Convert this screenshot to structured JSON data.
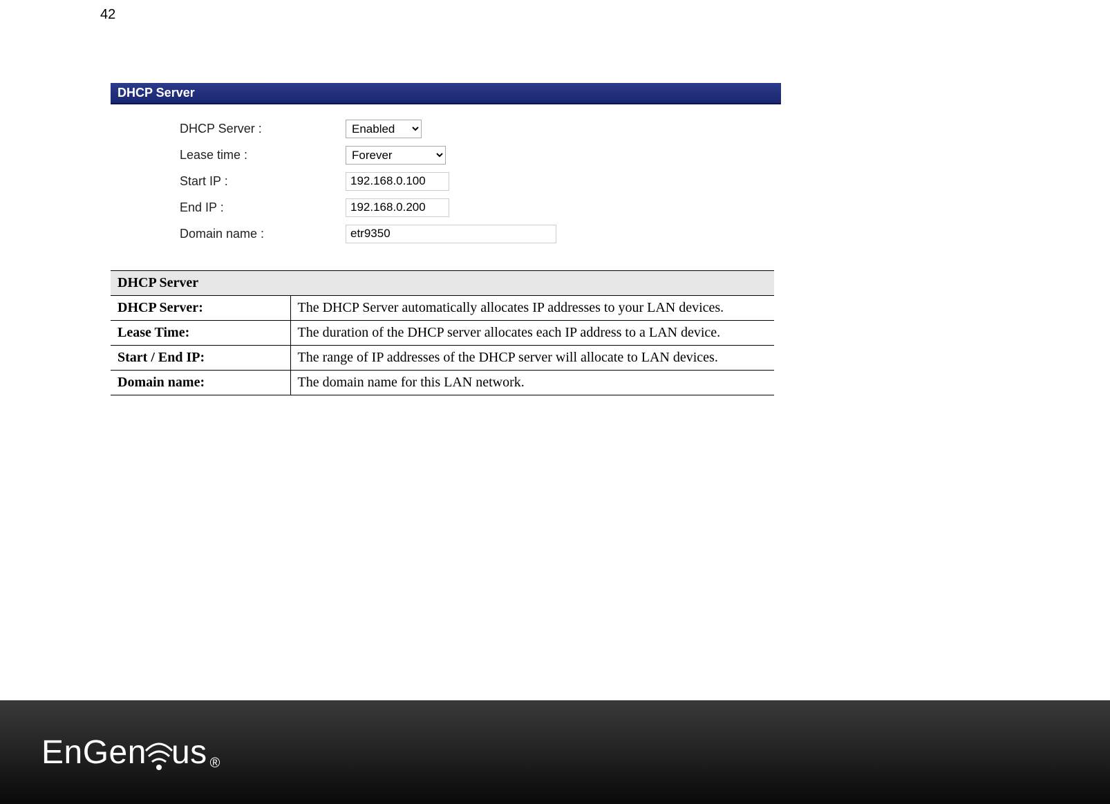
{
  "page_number": "42",
  "section": {
    "title": "DHCP Server"
  },
  "form": {
    "dhcp_server": {
      "label": "DHCP Server :",
      "value": "Enabled"
    },
    "lease_time": {
      "label": "Lease time :",
      "value": "Forever"
    },
    "start_ip": {
      "label": "Start IP :",
      "value": "192.168.0.100"
    },
    "end_ip": {
      "label": "End IP :",
      "value": "192.168.0.200"
    },
    "domain_name": {
      "label": "Domain name :",
      "value": "etr9350"
    }
  },
  "table": {
    "header": "DHCP Server",
    "rows": [
      {
        "label": "DHCP Server:",
        "desc": "The DHCP Server automatically allocates IP addresses to your LAN devices."
      },
      {
        "label": "Lease Time:",
        "desc": "The duration of the DHCP server allocates each IP address to a LAN device."
      },
      {
        "label": "Start / End IP:",
        "desc": "The range of IP addresses of the DHCP server will allocate to LAN devices."
      },
      {
        "label": "Domain name:",
        "desc": "The domain name for this LAN network."
      }
    ]
  },
  "footer": {
    "brand": "EnGenius",
    "reg": "®"
  }
}
